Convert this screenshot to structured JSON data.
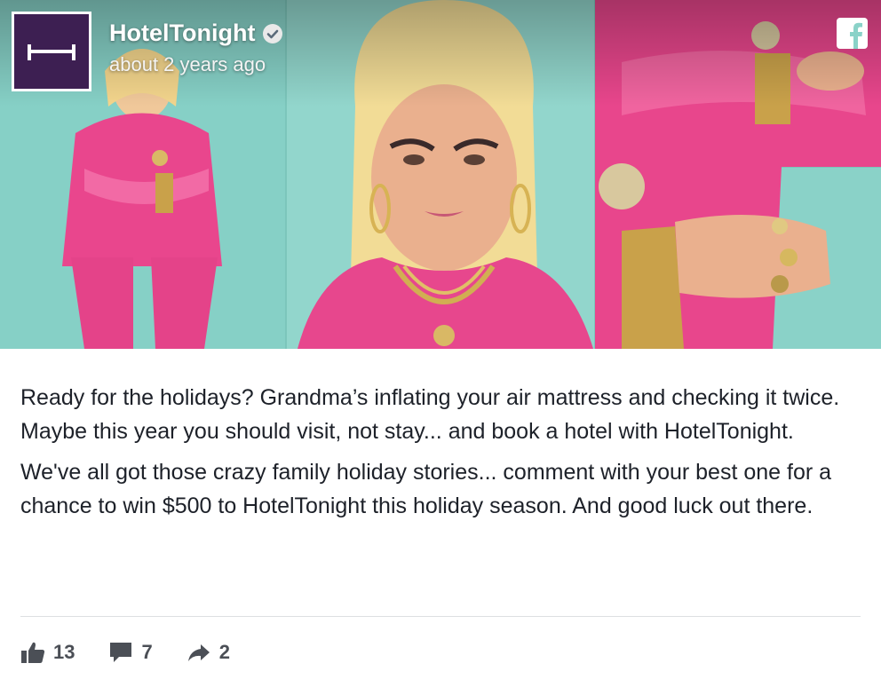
{
  "header": {
    "page_name": "HotelTonight",
    "timestamp": "about 2 years ago",
    "avatar_icon": "bed-logo-icon",
    "verified_icon": "verified-check-icon",
    "network_icon": "facebook-icon",
    "avatar_color": "#3d1f52"
  },
  "hero": {
    "image_icon": "grandma-pink-tracksuit-photo",
    "background_color": "#8ad3c8",
    "accent_color": "#e8478e"
  },
  "post": {
    "paragraphs": [
      "Ready for the holidays? Grandma’s inflating your air mattress and checking it twice. Maybe this year you should visit, not stay... and book a hotel with HotelTonight.",
      "We've all got those crazy family holiday stories... comment with your best one for a chance to win $500 to HotelTonight this holiday season. And good luck out there."
    ]
  },
  "actions": {
    "likes": "13",
    "comments": "7",
    "shares": "2",
    "like_icon": "thumbs-up-icon",
    "comment_icon": "comment-bubble-icon",
    "share_icon": "share-arrow-icon"
  }
}
